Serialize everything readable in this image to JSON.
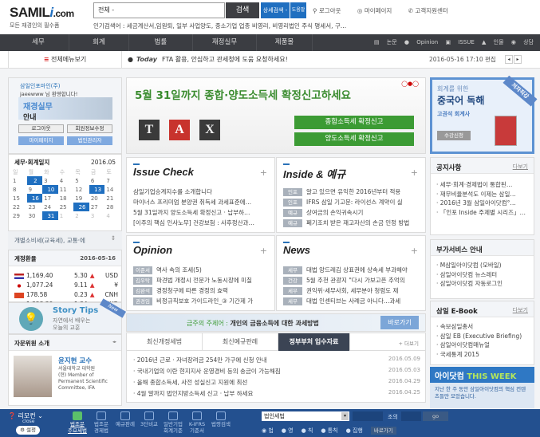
{
  "header": {
    "logo": "SAMIL",
    "logo_i": "i",
    "logo_com": ".com",
    "slogan": "모든 재경인의 필수품",
    "search_scope": "전체 -",
    "search_button": "검색",
    "advanced_search": "상세검색 -",
    "help": "도움말",
    "links": [
      "로그아웃",
      "마이페이지",
      "고객지원센터"
    ],
    "popular": "인기검색어 : 세금계산서,임원퇴, 일부 사업양도, 중소기업 업종 비영리, 비영리법인 주식 명세서, 구…"
  },
  "nav": {
    "items": [
      "세무",
      "회계",
      "법률",
      "재정실무",
      "제품몰"
    ],
    "right": [
      "논문",
      "Opinion",
      "ISSUE",
      "인물",
      "상담"
    ]
  },
  "today": {
    "all_menu": "전체메뉴보기",
    "label": "Today",
    "text": "FTA 활용, 안심하고 관세청에 도움 요청하세요!",
    "datetime": "2016-05-16 17:10 편집"
  },
  "user": {
    "company": "삼일인포마인(주)",
    "greeting": "jaeewww 님 환영합니다!",
    "promo_line1": "재경실무",
    "promo_line2": "안내",
    "buttons": [
      "로그아웃",
      "회원정보수정",
      "마이페이지",
      "법인관리자"
    ]
  },
  "calendar": {
    "title": "세무·회계일지",
    "month": "2016.05",
    "weekdays": [
      "일",
      "월",
      "화",
      "수",
      "목",
      "금",
      "토"
    ],
    "weeks": [
      [
        "1",
        "2",
        "3",
        "4",
        "5",
        "6",
        "7"
      ],
      [
        "8",
        "9",
        "10",
        "11",
        "12",
        "13",
        "14"
      ],
      [
        "15",
        "16",
        "17",
        "18",
        "19",
        "20",
        "21"
      ],
      [
        "22",
        "23",
        "24",
        "25",
        "26",
        "27",
        "28"
      ],
      [
        "29",
        "30",
        "31",
        "1",
        "2",
        "3",
        "4"
      ]
    ],
    "highlighted": [
      "2",
      "10",
      "13",
      "16",
      "26",
      "31"
    ],
    "selected_event": "개별소비세(교육세), 교통·에"
  },
  "fx": {
    "title": "계정환율",
    "date": "2016-05-16",
    "rows": [
      {
        "rate": "1,169.40",
        "change": "5.30",
        "dir": "up",
        "cur": "USD",
        "flag": "us"
      },
      {
        "rate": "1,077.24",
        "change": "9.11",
        "dir": "up",
        "cur": "¥",
        "flag": "jp"
      },
      {
        "rate": "178.58",
        "change": "0.23",
        "dir": "up",
        "cur": "CNH",
        "flag": "cn"
      },
      {
        "rate": "1,323.29",
        "change": "1.34",
        "dir": "down",
        "cur": "EUR",
        "flag": "eu"
      }
    ]
  },
  "story": {
    "title": "Story Tips",
    "sub1": "자연에서 배우는",
    "sub2": "오늘의 교훈",
    "badge": "New"
  },
  "advisor": {
    "title": "자문위원 소개",
    "name": "윤지현 교수",
    "desc": [
      "서울대학교 대학원",
      "(현) Member of",
      "Permanent Scientific",
      "Committee, IFA"
    ]
  },
  "banner": {
    "headline": "5월 31일까지 종합·양도소득세 확정신고하세요",
    "buttons": [
      "종합소득세 확정신고",
      "양도소득세 확정신고"
    ],
    "blocks": [
      "T",
      "A",
      "X"
    ]
  },
  "panels": [
    {
      "title": "Issue Check",
      "items": [
        {
          "text": "삼일기업승계지수를 소개합니다"
        },
        {
          "text": "마이너스 프리미엄 분양권 취득세 과세표준에…"
        },
        {
          "text": "5월 31일까지 양도소득세 확정신고 · 납부하…"
        },
        {
          "text": "[이주의 핵심 인사노무] 건강보험 : 사후정산과…"
        }
      ]
    },
    {
      "title": "Inside & 예규",
      "items": [
        {
          "tag": "인포",
          "text": "알고 있으면 유익한 2016년부터 적용"
        },
        {
          "tag": "인포",
          "text": "IFRS 삼일 기고문: 라이선스 계약이 실"
        },
        {
          "tag": "예규",
          "text": "상여금의 손익귀속시기"
        },
        {
          "tag": "예규",
          "text": "폐기조치 받은 재고자산의 손금 인정 방법"
        }
      ]
    },
    {
      "title": "Opinion",
      "items": [
        {
          "tag": "이준서",
          "text": "역사 속의 조세(5)"
        },
        {
          "tag": "김우탁",
          "text": "파견법 개정시 전문가 노동시장에 미칠"
        },
        {
          "tag": "김완석",
          "text": "경정청구에 따른 경정의 효력"
        },
        {
          "tag": "권경임",
          "text": "비정규직보호 가이드라인_③ 기간제 가"
        }
      ]
    },
    {
      "title": "News",
      "items": [
        {
          "tag": "세무",
          "text": "대법 앙드레김 상표권에 상속세 부과해야"
        },
        {
          "tag": "건강",
          "text": "5월 추천 관광지 \"다시 가보고픈 추억의"
        },
        {
          "tag": "세무",
          "text": "권익위·세무사회, 세무분야 청렴도 제"
        },
        {
          "tag": "세무",
          "text": "대법 인센티브는 사례금 아니다…과세"
        }
      ]
    }
  ],
  "theme": {
    "label": "금주의 주제어 :",
    "text": "개인의 금융소득에 대한 과세방법",
    "button": "바로가기"
  },
  "tabs": {
    "items": [
      "최신개정세법",
      "최신예규판례",
      "정부부처 입수자료"
    ],
    "active": 2,
    "more": "+ 더보기"
  },
  "latest": [
    {
      "text": "2016년 근로 · 자녀장려금 254만 가구에 신청 안내",
      "date": "2016.05.09"
    },
    {
      "text": "국내기업의 이란 현지지사 운영경비 등의 송금이 가능해짐",
      "date": "2016.05.03"
    },
    {
      "text": "올해 종합소득세, 사전 성실신고 지원에 최선",
      "date": "2016.04.29"
    },
    {
      "text": "4월 말까지 법인지방소득세 신고 · 납부 하세요",
      "date": "2016.04.25"
    }
  ],
  "ad": {
    "line1": "회계를 위한",
    "line2": "중국어 독해",
    "author": "고권석 회계사",
    "button": "수강신청",
    "ribbon": "저자직강"
  },
  "notice": {
    "title": "공지사항",
    "more": "다보기",
    "items": [
      "세무·회계·경제법이 통합된…",
      "재무비율분석도 이제는 삼일…",
      "2016년 3월 삼일아이닷컴°…",
      "「인포 Inside 주제별 시리즈」…"
    ]
  },
  "services": {
    "title": "부가서비스 안내",
    "items": [
      "M삼일아이닷컴 (모바일)",
      "삼일아이닷컴 뉴스레터",
      "삼일아이닷컴 자동로그인"
    ]
  },
  "ebook": {
    "title": "삼일 E-Book",
    "more": "다보기",
    "items": [
      "속보삼일총서",
      "삼일 EB (Executive Briefing)",
      "삼일아이닷컴매뉴얼",
      "국세통계 2015"
    ]
  },
  "week": {
    "title1": "아이닷컴",
    "title2": "THIS WEEK",
    "sub": "지난 한 주 동안 삼일아이닷컴의 핵심 컨텐츠들만 모았습니다."
  },
  "bottom": {
    "remote": "리모컨",
    "close": "close",
    "settings": "설정",
    "items": [
      "법조문 주요세법",
      "법조문 경제법",
      "예규판례",
      "3단비교",
      "일반기업 회계기준",
      "K-IFRS 기준서",
      "법령검색"
    ],
    "law_select": "법인세법",
    "article_label": "조의",
    "go": "go",
    "radios": [
      "법",
      "영",
      "칙",
      "통칙",
      "집행"
    ],
    "shortcut": "바로가기"
  },
  "colors": {
    "accent": "#1f6fc0",
    "nav": "#3b3d42",
    "green": "#3c9b34",
    "bottom": "#23508f"
  }
}
